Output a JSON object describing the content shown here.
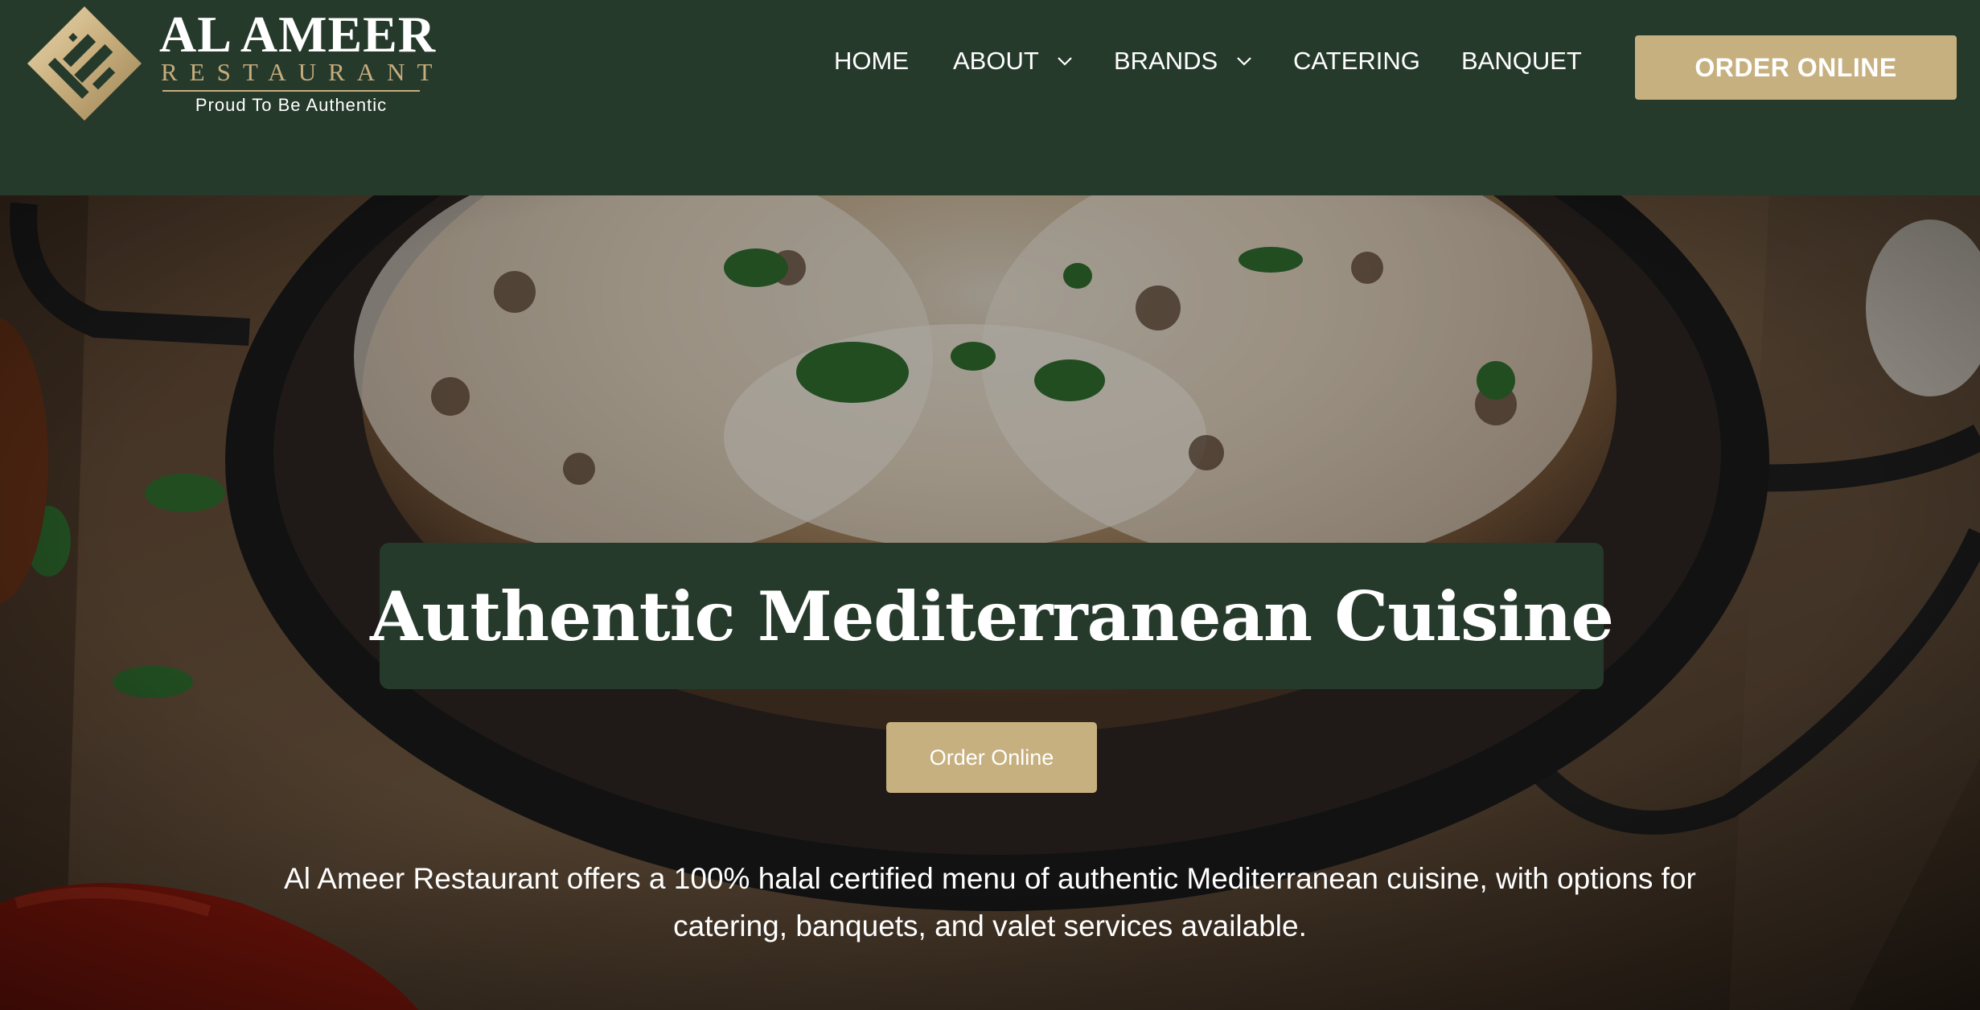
{
  "brand": {
    "title": "AL AMEER",
    "subtitle": "RESTAURANT",
    "tagline": "Proud To Be Authentic",
    "logo_icon": "calligraphy-logo-icon",
    "colors": {
      "primary": "#263a2c",
      "accent": "#c7b07f",
      "text": "#ffffff"
    }
  },
  "nav": {
    "items": [
      {
        "label": "HOME",
        "has_dropdown": false
      },
      {
        "label": "ABOUT",
        "has_dropdown": true
      },
      {
        "label": "BRANDS",
        "has_dropdown": true
      },
      {
        "label": "CATERING",
        "has_dropdown": false
      },
      {
        "label": "BANQUET",
        "has_dropdown": false
      }
    ],
    "cta": "ORDER ONLINE",
    "dropdown_icon": "chevron-down-icon"
  },
  "hero": {
    "title": "Authentic Mediterranean Cuisine",
    "button": "Order Online",
    "description": "Al Ameer Restaurant offers a 100% halal certified menu of authentic Mediterranean cuisine, with options for catering, banquets, and valet services available.",
    "background": "grilled chicken in cream sauce with parsley in a black pan"
  }
}
